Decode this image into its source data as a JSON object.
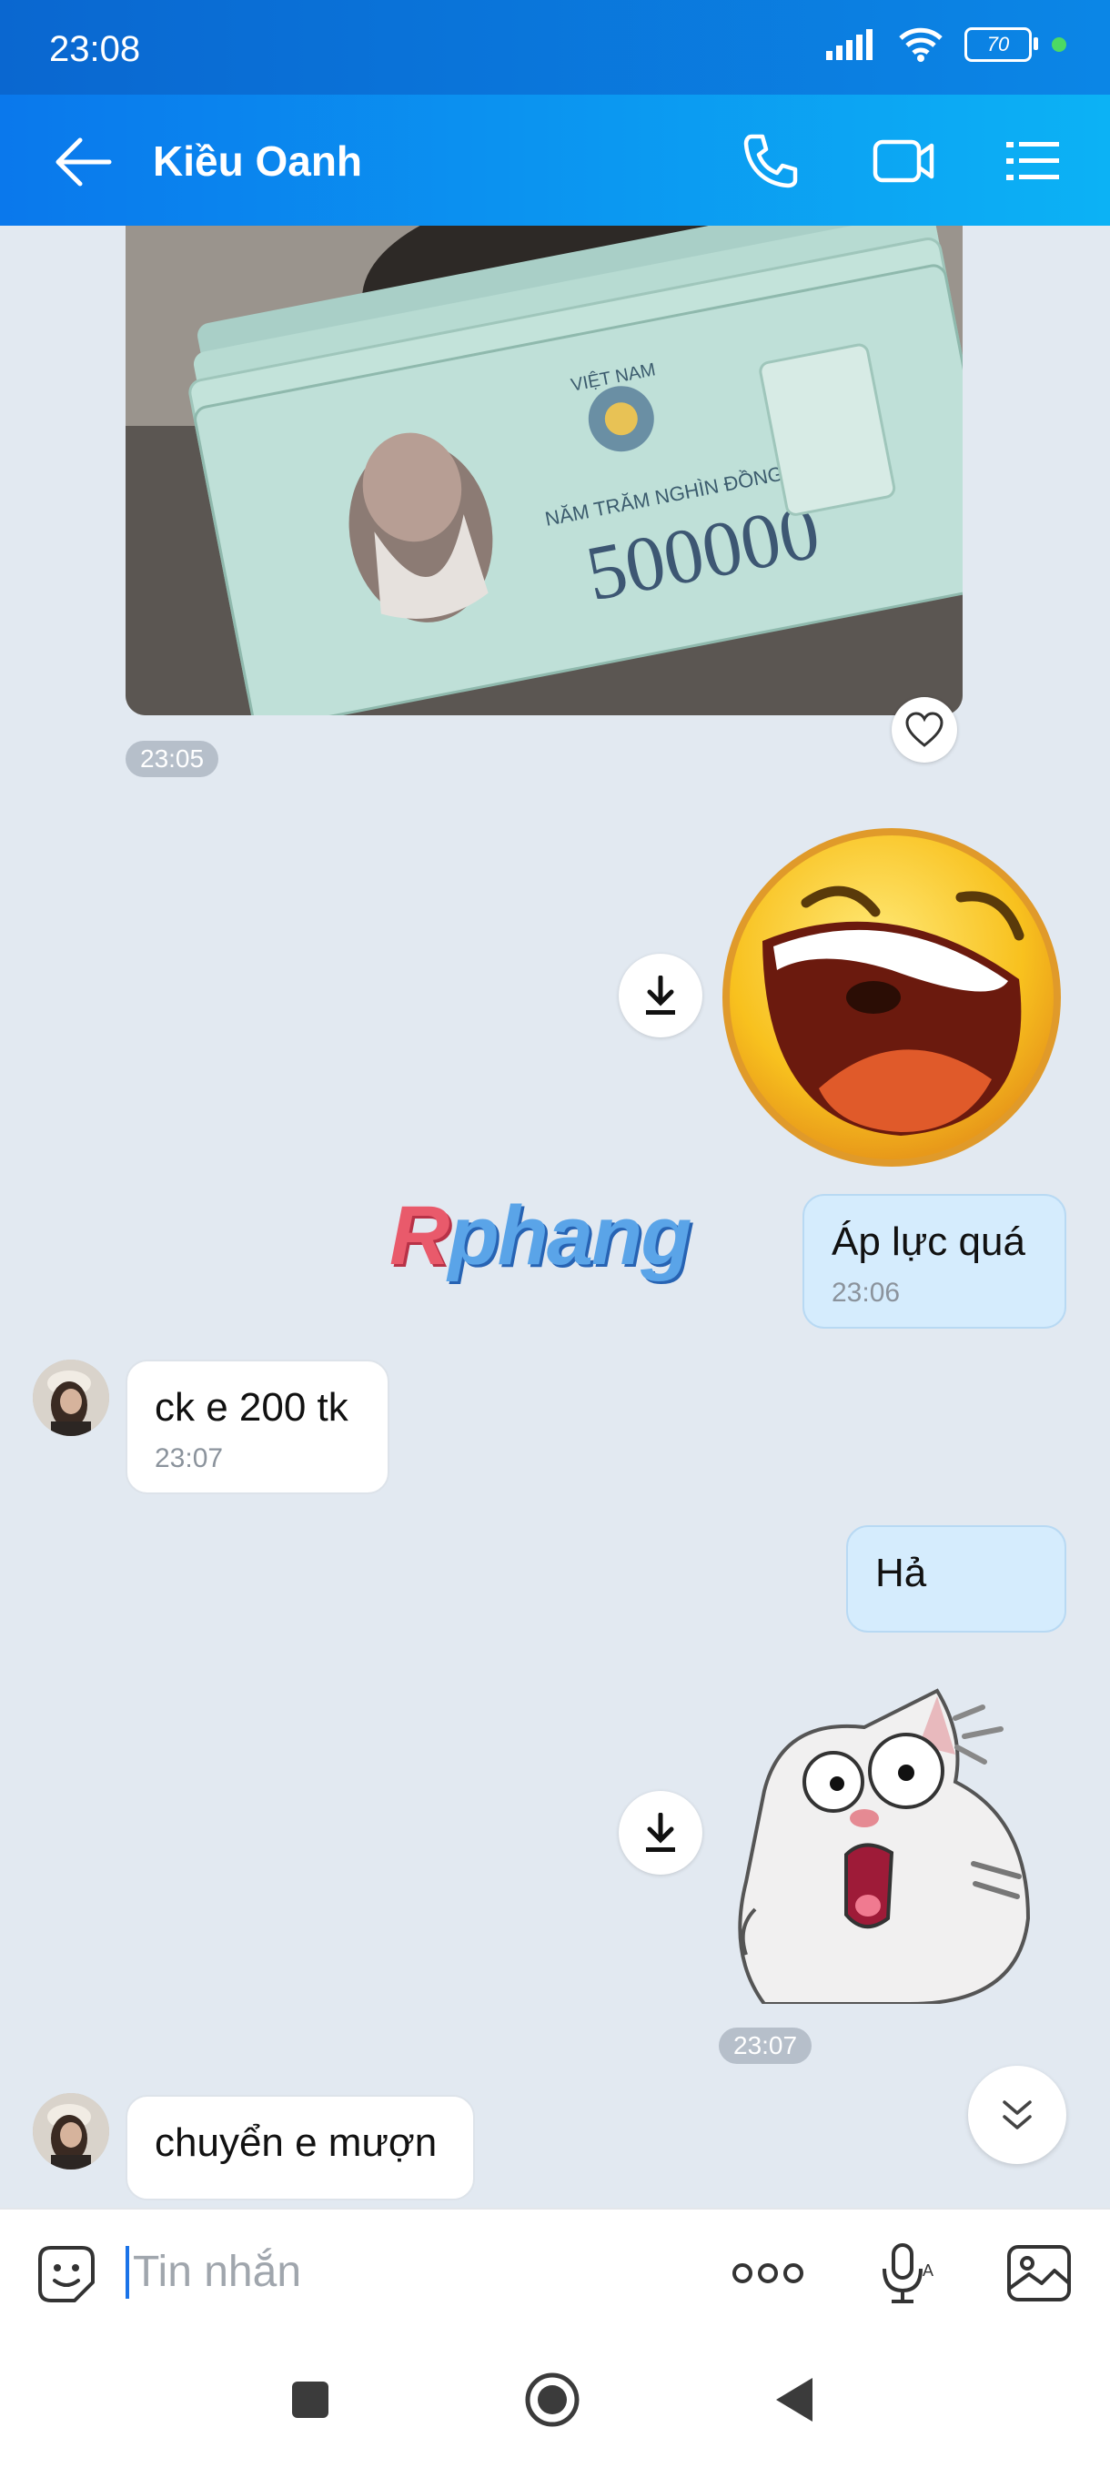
{
  "status_bar": {
    "time": "23:08",
    "battery": "70"
  },
  "header": {
    "contact_name": "Kiều Oanh"
  },
  "messages": {
    "image_time": "23:05",
    "out_text_1": "Áp lực quá",
    "out_time_1": "23:06",
    "in_text_1": "ck e 200 tk",
    "in_time_1": "23:07",
    "out_text_2": "Hả",
    "sticker_time": "23:07",
    "in_text_2": "chuyển e mượn"
  },
  "banknote": {
    "amount": "500000",
    "words": "NĂM TRĂM NGHÌN ĐỒNG",
    "country": "VIỆT NAM"
  },
  "watermark": {
    "first_letter": "R",
    "rest": "phang"
  },
  "input": {
    "placeholder": "Tin nhắn"
  },
  "colors": {
    "header_start": "#0a78ec",
    "header_end": "#0cb2f5",
    "bubble_out": "#d5ecfd",
    "chat_bg": "#e2e9f1"
  }
}
